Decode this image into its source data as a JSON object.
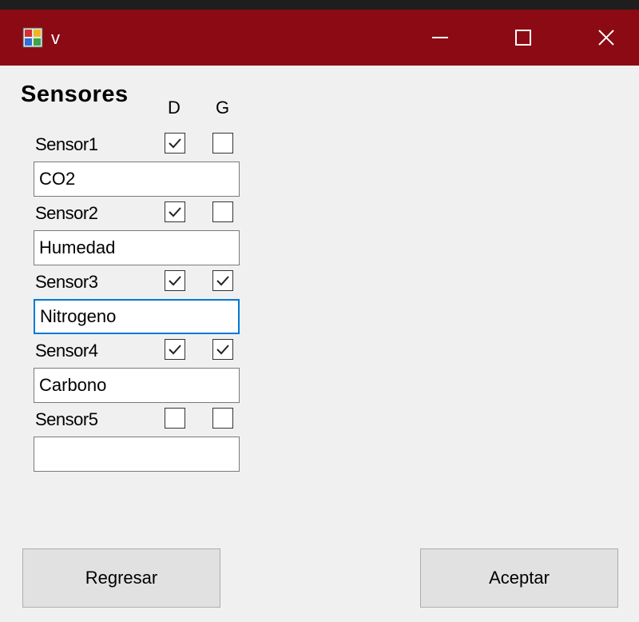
{
  "window": {
    "title": "v"
  },
  "form": {
    "heading": "Sensores",
    "col_d": "D",
    "col_g": "G",
    "sensors": [
      {
        "label": "Sensor1",
        "d": true,
        "g": false,
        "value": "CO2"
      },
      {
        "label": "Sensor2",
        "d": true,
        "g": false,
        "value": "Humedad"
      },
      {
        "label": "Sensor3",
        "d": true,
        "g": true,
        "value": "Nitrogeno"
      },
      {
        "label": "Sensor4",
        "d": true,
        "g": true,
        "value": "Carbono"
      },
      {
        "label": "Sensor5",
        "d": false,
        "g": false,
        "value": ""
      }
    ]
  },
  "buttons": {
    "back": "Regresar",
    "accept": "Aceptar"
  },
  "colors": {
    "titlebar": "#8b0a14",
    "focus": "#0078d7",
    "background": "#f0f0f0"
  }
}
